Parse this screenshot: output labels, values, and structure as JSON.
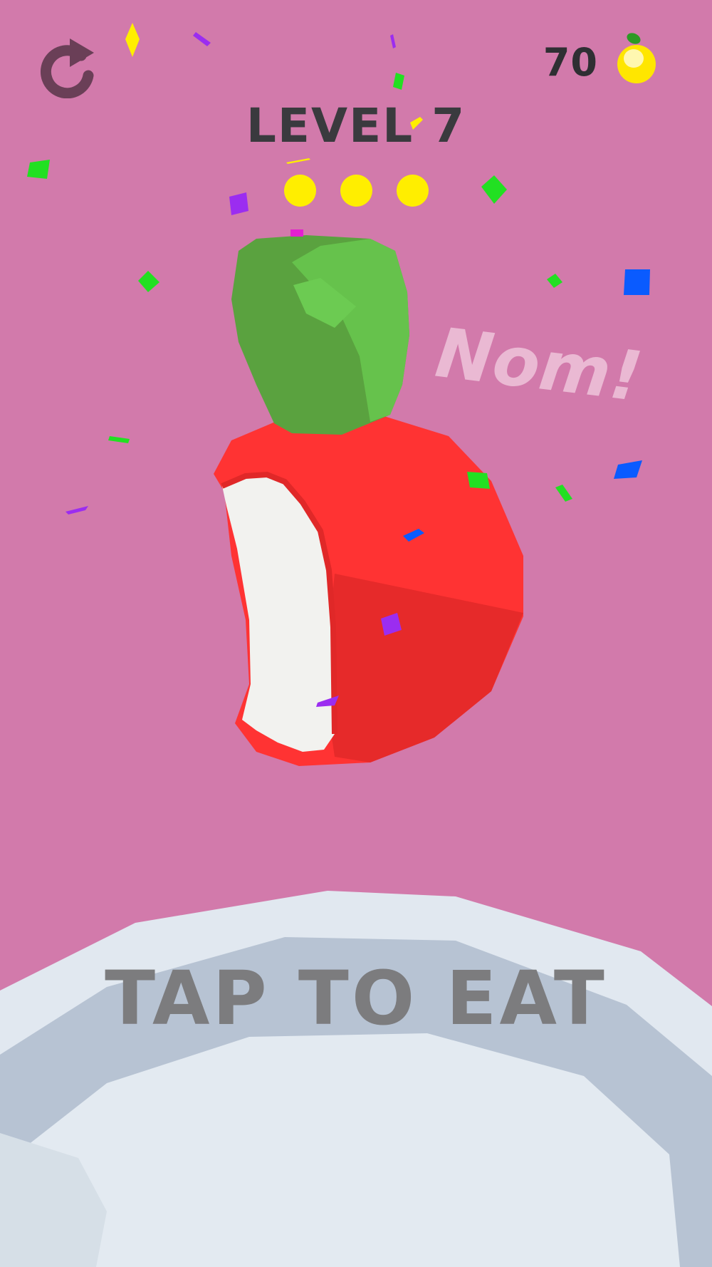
{
  "hud": {
    "coins": "70",
    "restart_icon": "restart-icon",
    "coin_icon": "lemon-coin-icon"
  },
  "level": {
    "title": "LEVEL 7",
    "progress_total": 3,
    "progress_filled": 3
  },
  "feedback": {
    "text": "Nom!"
  },
  "action": {
    "label": "TAP TO EAT"
  },
  "colors": {
    "background": "#d27aab",
    "apple": "#ff3333",
    "leaf": "#5cb84a",
    "progress_dot": "#ffee00",
    "plate": "#dde6ef"
  }
}
